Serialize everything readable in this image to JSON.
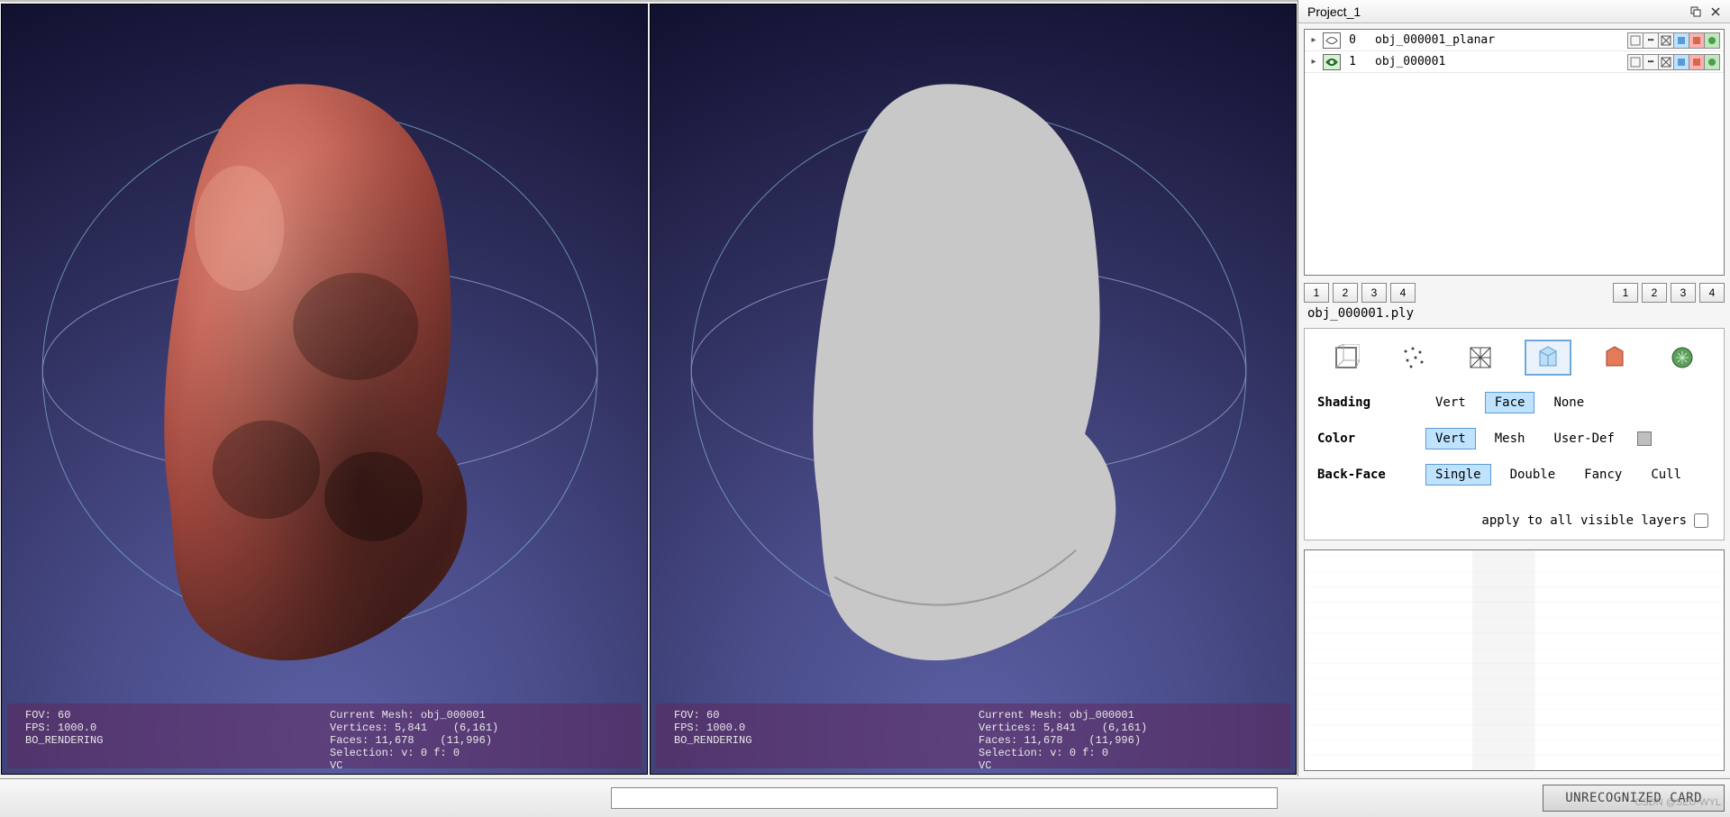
{
  "panel": {
    "title": "Project_1"
  },
  "layers": [
    {
      "visible": false,
      "index": "0",
      "name": "obj_000001_planar"
    },
    {
      "visible": true,
      "index": "1",
      "name": "obj_000001"
    }
  ],
  "numrow_left": [
    "1",
    "2",
    "3",
    "4"
  ],
  "numrow_right": [
    "1",
    "2",
    "3",
    "4"
  ],
  "current_file": "obj_000001.ply",
  "shading": {
    "label": "Shading",
    "options": [
      "Vert",
      "Face",
      "None"
    ],
    "selected": "Face"
  },
  "color": {
    "label": "Color",
    "options": [
      "Vert",
      "Mesh",
      "User-Def"
    ],
    "selected": "Vert"
  },
  "backface": {
    "label": "Back-Face",
    "options": [
      "Single",
      "Double",
      "Fancy",
      "Cull"
    ],
    "selected": "Single"
  },
  "apply_label": "apply to all visible layers",
  "viewport_info": {
    "left_col": "FOV: 60\nFPS: 1000.0\nBO_RENDERING",
    "right_col": "Current Mesh: obj_000001\nVertices: 5,841    (6,161)\nFaces: 11,678    (11,996)\nSelection: v: 0 f: 0\nVC"
  },
  "statusbar": {
    "text": "UNRECOGNIZED CARD"
  },
  "watermark": "CSDN @SEU-WYL"
}
